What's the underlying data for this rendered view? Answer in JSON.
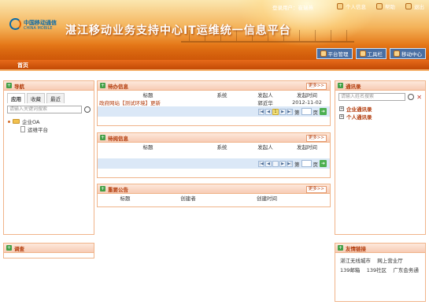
{
  "header": {
    "logo_cn": "中国移动通信",
    "logo_en": "CHINA MOBILE",
    "title": "湛江移动业务支持中心IT运维统一信息平台",
    "user_label": "登录用户：",
    "user_name": "崔瑞燕",
    "links": [
      {
        "label": "个人信息",
        "icon": "person-icon"
      },
      {
        "label": "帮助",
        "icon": "help-icon"
      },
      {
        "label": "退出",
        "icon": "exit-icon"
      }
    ],
    "tabs": [
      {
        "label": "平台管理",
        "icon": "monitor-icon"
      },
      {
        "label": "工具栏",
        "icon": "tools-icon"
      },
      {
        "label": "移动中心",
        "icon": "mobile-icon"
      }
    ]
  },
  "nav": {
    "home": "首页"
  },
  "left_nav": {
    "title": "导航",
    "tabs": [
      "应用",
      "收藏",
      "最近"
    ],
    "search_placeholder": "请输入关键词搜索",
    "tree": [
      {
        "label": "企业OA"
      },
      {
        "label": "运维平台"
      }
    ]
  },
  "todo": {
    "title": "待办信息",
    "more": "更多>>",
    "columns": [
      "标题",
      "系统",
      "发起人",
      "发起时间"
    ],
    "rows": [
      {
        "title": "政府网站【测试环境】更新",
        "system": "",
        "initiator": "郭近华",
        "time": "2012-11-02"
      }
    ],
    "pager": {
      "current": "1",
      "page_label": "第",
      "page_unit": "页"
    }
  },
  "notice": {
    "title": "待阅信息",
    "more": "更多>>",
    "columns": [
      "标题",
      "系统",
      "发起人",
      "发起时间"
    ],
    "pager": {
      "current": "",
      "page_label": "第",
      "page_unit": "页"
    }
  },
  "announce": {
    "title": "重要公告",
    "more": "更多>>",
    "columns": [
      "标题",
      "创建者",
      "创建时间"
    ]
  },
  "contacts": {
    "title": "通讯录",
    "search_placeholder": "请输入姓名搜索",
    "items": [
      "企业通讯录",
      "个人通讯录"
    ]
  },
  "survey": {
    "title": "调查"
  },
  "friend_links": {
    "title": "友情链接",
    "row1": [
      "湛江无线城市",
      "网上营业厅"
    ],
    "row2": [
      "139邮箱",
      "139社区",
      "广东会务通"
    ]
  },
  "colors": {
    "accent": "#e66a1a",
    "panel_border": "#f0b48a",
    "title_red": "#b23a0a"
  }
}
